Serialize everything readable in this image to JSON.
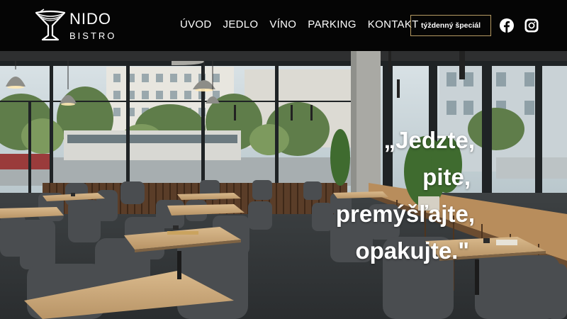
{
  "brand": {
    "name": "NIDO",
    "sub": "BISTRO"
  },
  "nav": {
    "items": [
      {
        "label": "ÚVOD"
      },
      {
        "label": "JEDLO"
      },
      {
        "label": "VÍNO"
      },
      {
        "label": "PARKING"
      },
      {
        "label": "KONTAKT"
      }
    ]
  },
  "cta": {
    "label": "týždenný špeciál",
    "border_color": "#b59a62"
  },
  "social": {
    "facebook": "facebook-icon",
    "instagram": "instagram-icon"
  },
  "hero": {
    "quote_lines": [
      "„Jedzte,",
      "pite,",
      "premýšľajte,",
      "opakujte.\""
    ]
  }
}
